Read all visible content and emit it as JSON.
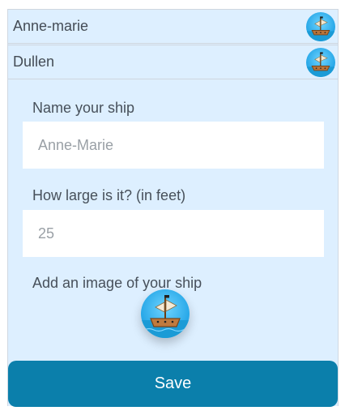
{
  "ship_list": [
    {
      "name": "Anne-marie",
      "icon": "pirate-ship-icon"
    },
    {
      "name": "Dullen",
      "icon": "pirate-ship-icon"
    }
  ],
  "form": {
    "name_label": "Name your ship",
    "name_placeholder": "Anne-Marie",
    "size_label": "How large is it? (in feet)",
    "size_placeholder": "25",
    "image_label": "Add an image of your ship",
    "image_icon": "pirate-ship-icon",
    "save_label": "Save"
  },
  "colors": {
    "panel_background": "#ddefff",
    "save_button": "#0b7fab",
    "save_text": "#ffffff"
  }
}
